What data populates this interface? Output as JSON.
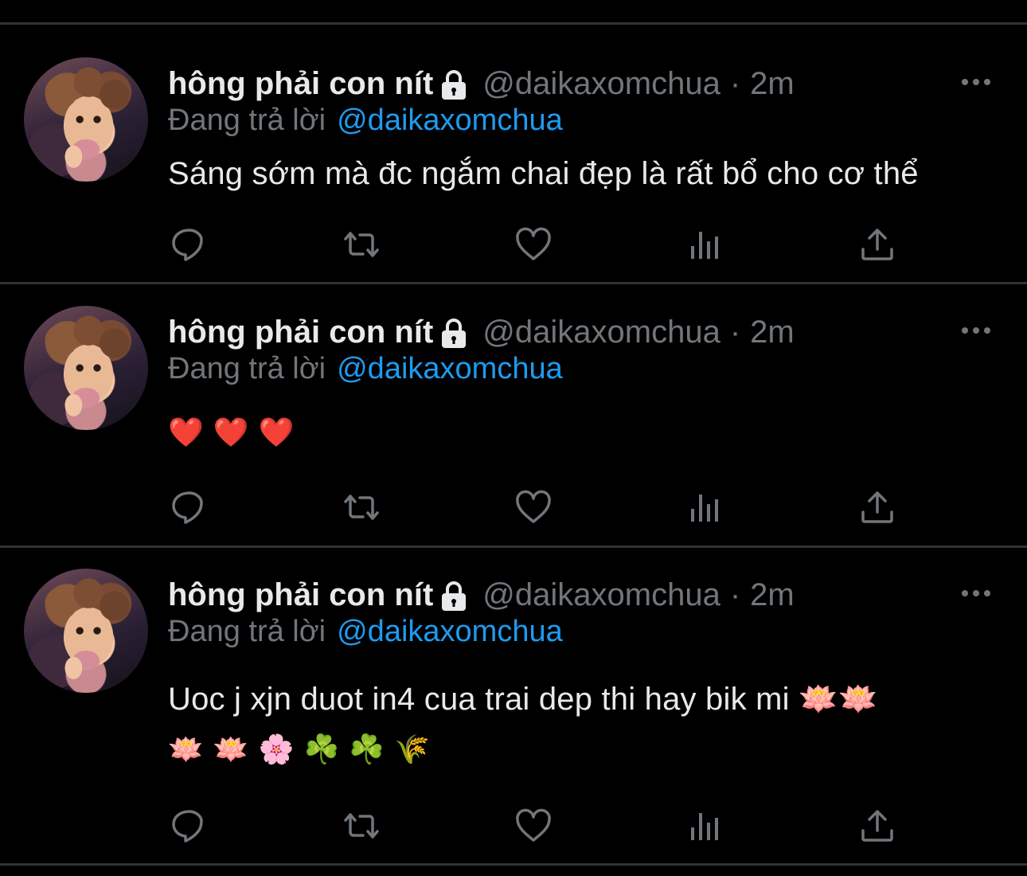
{
  "colors": {
    "background": "#000000",
    "text": "#e7e9ea",
    "secondary": "#71767b",
    "link": "#1d9bf0",
    "divider": "#2f3336"
  },
  "tweets": [
    {
      "display_name": "hông phải con nít",
      "handle": "@daikaxomchua",
      "separator": "·",
      "time": "2m",
      "reply_prefix": "Đang trả lời",
      "reply_handle": "@daikaxomchua",
      "text": "Sáng sớm mà đc ngắm chai đẹp là rất bổ cho cơ thể",
      "text2": ""
    },
    {
      "display_name": "hông phải con nít",
      "handle": "@daikaxomchua",
      "separator": "·",
      "time": "2m",
      "reply_prefix": "Đang trả lời",
      "reply_handle": "@daikaxomchua",
      "text": "❤️❤️❤️",
      "text2": ""
    },
    {
      "display_name": "hông phải con nít",
      "handle": "@daikaxomchua",
      "separator": "·",
      "time": "2m",
      "reply_prefix": "Đang trả lời",
      "reply_handle": "@daikaxomchua",
      "text": "Uoc j xjn duot in4 cua trai dep thi hay bik mi 🪷🪷",
      "text2": "🪷🪷🌸☘️☘️🌾"
    }
  ],
  "icons": {
    "lock": "lock-icon",
    "more": "more-icon",
    "reply": "reply-icon",
    "retweet": "retweet-icon",
    "like": "heart-icon",
    "views": "views-icon",
    "share": "share-icon"
  }
}
